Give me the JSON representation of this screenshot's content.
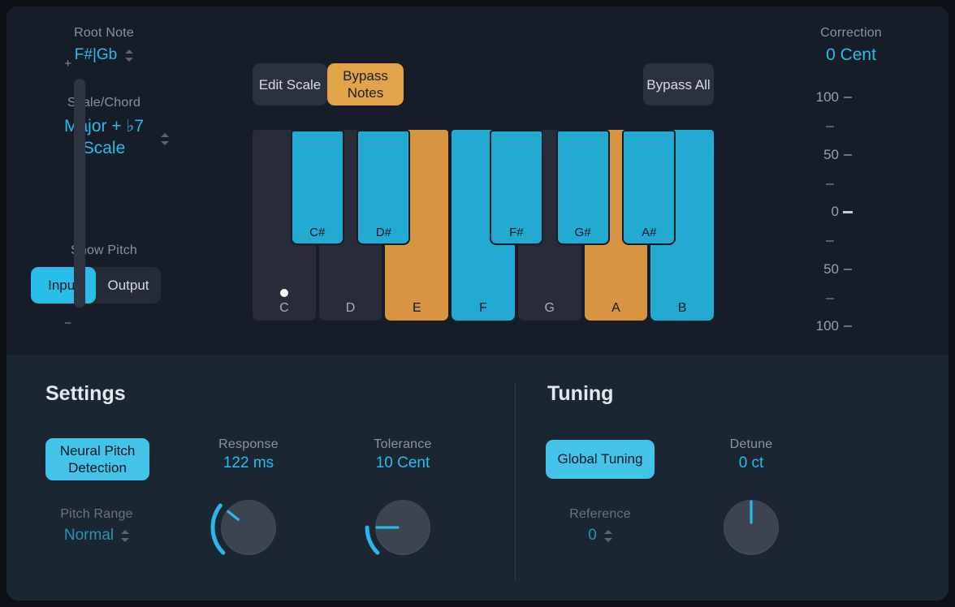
{
  "root_note": {
    "label": "Root Note",
    "value": "F#|Gb",
    "chevron_icon": "chevron-updown-icon"
  },
  "scale_chord": {
    "label": "Scale/Chord",
    "value_line1": "Major + ♭7",
    "value_line2": "Scale",
    "chevron_icon": "chevron-updown-icon"
  },
  "show_pitch": {
    "label": "Show Pitch",
    "input": "Input",
    "output": "Output",
    "selected": "Input"
  },
  "buttons": {
    "edit_scale": "Edit Scale",
    "bypass_notes": "Bypass Notes",
    "bypass_all": "Bypass All",
    "bypass_notes_active": true,
    "accent_orange": "#e2a349",
    "accent_blue": "#43c3e8"
  },
  "keyboard": {
    "white_keys": [
      {
        "label": "C",
        "state": "off",
        "dot": true
      },
      {
        "label": "D",
        "state": "off",
        "dot": false
      },
      {
        "label": "E",
        "state": "bypass",
        "dot": false
      },
      {
        "label": "F",
        "state": "in-scale",
        "dot": false
      },
      {
        "label": "G",
        "state": "off",
        "dot": false
      },
      {
        "label": "A",
        "state": "bypass",
        "dot": false
      },
      {
        "label": "B",
        "state": "in-scale",
        "dot": false
      }
    ],
    "black_keys": [
      {
        "label": "C#",
        "state": "in-scale"
      },
      {
        "label": "D#",
        "state": "in-scale"
      },
      {
        "label": "F#",
        "state": "in-scale"
      },
      {
        "label": "G#",
        "state": "in-scale"
      },
      {
        "label": "A#",
        "state": "in-scale"
      }
    ],
    "colors": {
      "in_scale": "#22aad2",
      "bypass": "#d79541",
      "off": "#272c38"
    }
  },
  "correction": {
    "label": "Correction",
    "value": "0 Cent",
    "plus_sign": "+",
    "minus_sign": "−",
    "ticks": [
      "100",
      "50",
      "0",
      "50",
      "100"
    ]
  },
  "settings": {
    "title": "Settings",
    "neural_pitch_detection": "Neural Pitch Detection",
    "pitch_range": {
      "label": "Pitch Range",
      "value": "Normal",
      "chevron_icon": "chevron-updown-icon"
    },
    "response": {
      "label": "Response",
      "value": "122 ms"
    },
    "tolerance": {
      "label": "Tolerance",
      "value": "10 Cent"
    }
  },
  "tuning": {
    "title": "Tuning",
    "global_tuning": "Global Tuning",
    "reference": {
      "label": "Reference",
      "value": "0",
      "chevron_icon": "chevron-updown-icon"
    },
    "detune": {
      "label": "Detune",
      "value": "0 ct"
    }
  }
}
